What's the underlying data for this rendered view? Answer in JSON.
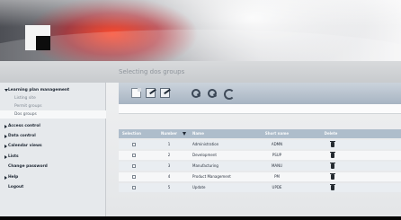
{
  "page": {
    "title": "Selecting dos groups"
  },
  "sidebar": {
    "items": [
      {
        "label": "Learning plan management",
        "state": "open"
      },
      {
        "label": "Listing site",
        "state": "sub"
      },
      {
        "label": "Permit groups",
        "state": "sub"
      },
      {
        "label": "Dos groups",
        "state": "sub-active"
      },
      {
        "label": "Access control",
        "state": "closed"
      },
      {
        "label": "Data control",
        "state": "closed"
      },
      {
        "label": "Calendar views",
        "state": "closed"
      },
      {
        "label": "Lists",
        "state": "closed"
      },
      {
        "label": "Change password",
        "state": "plain"
      },
      {
        "label": "Help",
        "state": "closed"
      },
      {
        "label": "Logout",
        "state": "plain"
      }
    ]
  },
  "toolbar": {
    "icons": [
      "new-document-icon",
      "edit-icon",
      "edit-alt-icon",
      "search-icon",
      "zoom-icon",
      "refresh-icon"
    ]
  },
  "table": {
    "headers": {
      "select": "Selection",
      "number": "Number",
      "name": "Name",
      "short_name": "Short name",
      "delete": "Delete"
    },
    "rows": [
      {
        "number": "1",
        "name": "Administration",
        "short_name": "ADMN"
      },
      {
        "number": "2",
        "name": "Development",
        "short_name": "PSUP"
      },
      {
        "number": "3",
        "name": "Manufacturing",
        "short_name": "MANU"
      },
      {
        "number": "4",
        "name": "Product Management",
        "short_name": "PM"
      },
      {
        "number": "5",
        "name": "Update",
        "short_name": "UPDE"
      }
    ]
  },
  "colors": {
    "banner_red": "#d61d23",
    "toolbar_blue": "#aebdcb",
    "sidebar": "#e6e9ec"
  }
}
